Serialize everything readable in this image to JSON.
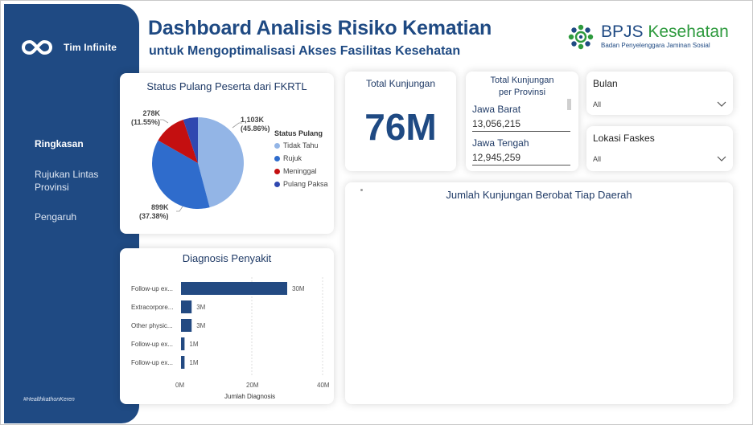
{
  "sidebar": {
    "brand": "Tim Infinite",
    "nav": [
      {
        "label": "Ringkasan",
        "active": true
      },
      {
        "label": "Rujukan Lintas Provinsi",
        "active": false
      },
      {
        "label": "Pengaruh",
        "active": false
      }
    ],
    "hashtag": "#HealthkathonKeren"
  },
  "header": {
    "title": "Dashboard Analisis Risiko Kematian",
    "subtitle": "untuk Mengoptimalisasi Akses Fasilitas Kesehatan",
    "logo_name_part1": "BPJS",
    "logo_name_part2": "Kesehatan",
    "logo_sub": "Badan Penyelenggara Jaminan Sosial"
  },
  "status_card": {
    "title": "Status Pulang Peserta dari FKRTL",
    "legend_title": "Status Pulang",
    "labels": [
      {
        "value": "1,103K",
        "pct": "(45.86%)"
      },
      {
        "value": "899K",
        "pct": "(37.38%)"
      },
      {
        "value": "278K",
        "pct": "(11.55%)"
      }
    ]
  },
  "total_card": {
    "title": "Total Kunjungan",
    "value": "76M"
  },
  "province_card": {
    "title_line1": "Total Kunjungan",
    "title_line2": "per Provinsi",
    "rows": [
      {
        "name": "Jawa Barat",
        "value": "13,056,215"
      },
      {
        "name": "Jawa Tengah",
        "value": "12,945,259"
      }
    ]
  },
  "filters": {
    "bulan": {
      "label": "Bulan",
      "value": "All"
    },
    "lokasi": {
      "label": "Lokasi Faskes",
      "value": "All"
    }
  },
  "map_card": {
    "title": "Jumlah Kunjungan Berobat Tiap Daerah"
  },
  "diagnosis_card": {
    "title": "Diagnosis Penyakit"
  },
  "chart_data": [
    {
      "type": "pie",
      "title": "Status Pulang Peserta dari FKRTL",
      "legend_title": "Status Pulang",
      "legend_position": "right",
      "categories": [
        "Tidak Tahu",
        "Rujuk",
        "Meninggal",
        "Pulang Paksa"
      ],
      "values": [
        1103,
        899,
        278,
        125
      ],
      "percent": [
        45.86,
        37.38,
        11.55,
        5.21
      ],
      "colors": [
        "#93b5e6",
        "#2f6ccc",
        "#c40f10",
        "#3048b0"
      ]
    },
    {
      "type": "bar",
      "orientation": "horizontal",
      "title": "Diagnosis Penyakit",
      "categories": [
        "Follow-up ex...",
        "Extracorpore...",
        "Other physic...",
        "Follow-up ex...",
        "Follow-up ex..."
      ],
      "values": [
        30,
        3,
        3,
        1,
        1
      ],
      "value_labels": [
        "30M",
        "3M",
        "3M",
        "1M",
        "1M"
      ],
      "xlabel": "Jumlah Diagnosis",
      "xticks": [
        "0M",
        "20M",
        "40M"
      ],
      "xlim": [
        0,
        40
      ],
      "color": "#234a82"
    }
  ]
}
